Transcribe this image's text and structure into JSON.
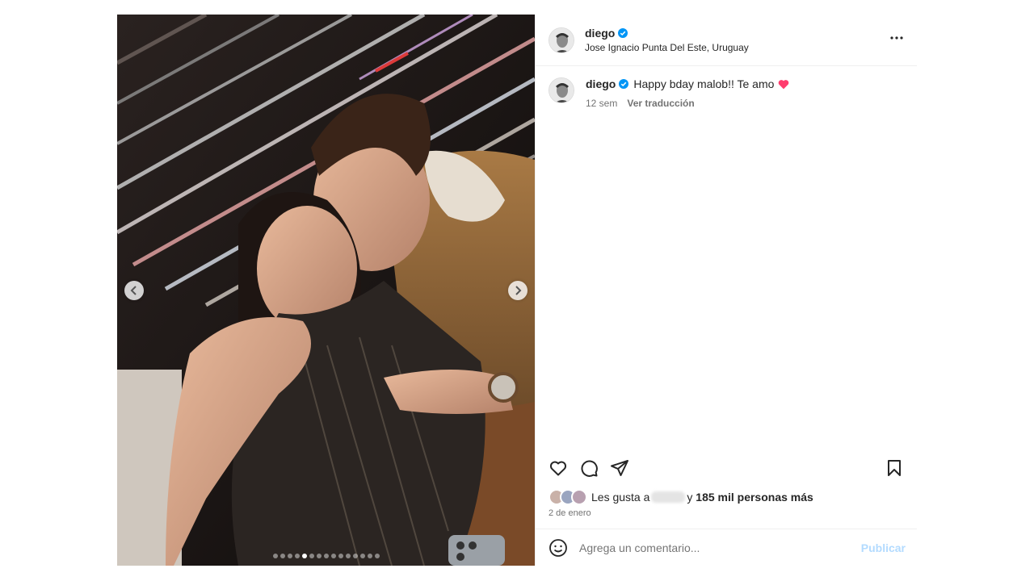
{
  "post": {
    "username": "diego",
    "location": "Jose Ignacio Punta Del Este, Uruguay",
    "caption": "Happy bday malob!! Te amo",
    "caption_age": "12 sem",
    "translate_label": "Ver traducción",
    "likes_prefix": "Les gusta a",
    "likes_mid": "y",
    "likes_count": "185 mil personas más",
    "date": "2 de enero",
    "comment_placeholder": "Agrega un comentario...",
    "publish_label": "Publicar",
    "carousel_total": 15,
    "carousel_active": 4
  },
  "icons": {
    "more": "more-horizontal-icon",
    "like": "heart-icon",
    "comment": "comment-icon",
    "share": "paper-plane-icon",
    "save": "bookmark-icon",
    "emoji": "smiley-icon",
    "verified": "verified-badge-icon",
    "prev": "chevron-left-icon",
    "next": "chevron-right-icon"
  },
  "colors": {
    "verified": "#0095f6",
    "heart": "#ff3040",
    "publish_disabled": "#b3dbff",
    "muted": "#737373"
  }
}
